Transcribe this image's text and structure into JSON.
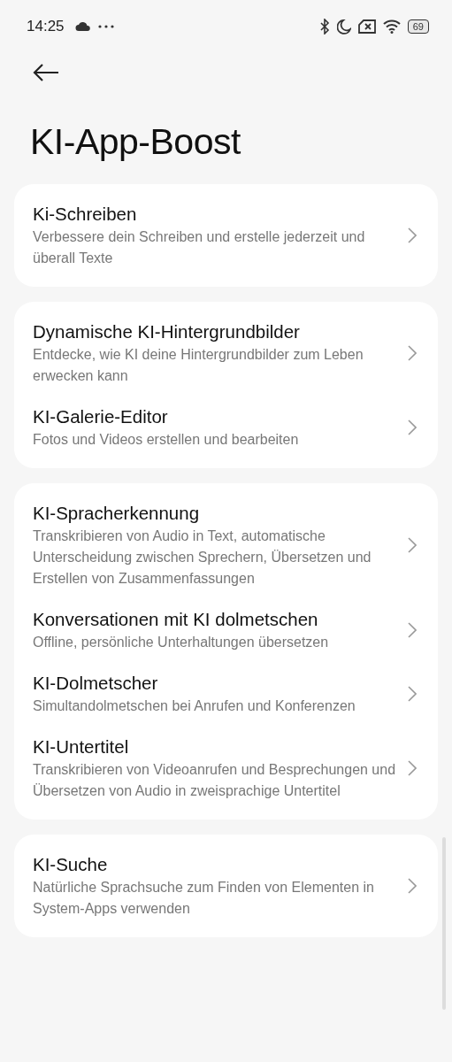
{
  "status_bar": {
    "time": "14:25",
    "battery": "69"
  },
  "title": "KI-App-Boost",
  "groups": [
    {
      "items": [
        {
          "title": "Ki-Schreiben",
          "subtitle": "Verbessere dein Schreiben und erstelle jederzeit und überall Texte"
        }
      ]
    },
    {
      "items": [
        {
          "title": "Dynamische KI-Hintergrundbilder",
          "subtitle": "Entdecke, wie KI deine Hintergrundbilder zum Leben erwecken kann"
        },
        {
          "title": "KI-Galerie-Editor",
          "subtitle": "Fotos und Videos erstellen und bearbeiten"
        }
      ]
    },
    {
      "items": [
        {
          "title": "KI-Spracherkennung",
          "subtitle": "Transkribieren von Audio in Text, automatische Unterscheidung zwischen Sprechern, Übersetzen und Erstellen von Zusammenfassungen"
        },
        {
          "title": "Konversationen mit KI dolmetschen",
          "subtitle": "Offline, persönliche Unterhaltungen übersetzen"
        },
        {
          "title": "KI-Dolmetscher",
          "subtitle": "Simultandolmetschen bei Anrufen und Konferenzen"
        },
        {
          "title": "KI-Untertitel",
          "subtitle": "Transkribieren von Videoanrufen und Besprechungen und Übersetzen von Audio in zweisprachige Untertitel"
        }
      ]
    },
    {
      "items": [
        {
          "title": "KI-Suche",
          "subtitle": "Natürliche Sprachsuche zum Finden von Elementen in System-Apps verwenden"
        }
      ]
    }
  ]
}
